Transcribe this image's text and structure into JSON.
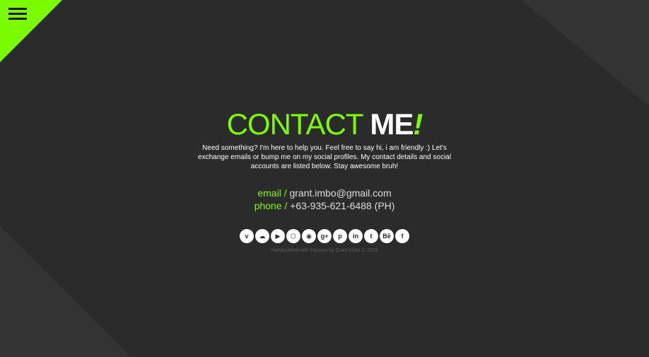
{
  "header": {
    "title_part1": "CONTACT",
    "title_part2": "ME",
    "title_part3": "!"
  },
  "intro": {
    "text": "Need something? I'm here to help you. Feel free to say hi, i am friendly :) Let's exchange emails or bump me on my social profiles. My contact details and social accounts are listed below. Stay awesome bruh!"
  },
  "contact": {
    "email_label": "email /",
    "email_value": "grant.imbo@gmail.com",
    "phone_label": "phone /",
    "phone_value": "+63-935-621-6488 (PH)"
  },
  "social": [
    {
      "name": "vimeo-icon",
      "glyph": "v"
    },
    {
      "name": "soundcloud-icon",
      "glyph": "☁"
    },
    {
      "name": "youtube-icon",
      "glyph": "▶"
    },
    {
      "name": "codepen-icon",
      "glyph": "⬡"
    },
    {
      "name": "github-icon",
      "glyph": "◉"
    },
    {
      "name": "google-plus-icon",
      "glyph": "g+"
    },
    {
      "name": "pinterest-icon",
      "glyph": "p"
    },
    {
      "name": "linkedin-icon",
      "glyph": "in"
    },
    {
      "name": "twitter-icon",
      "glyph": "t"
    },
    {
      "name": "behance-icon",
      "glyph": "Bē"
    },
    {
      "name": "facebook-icon",
      "glyph": "f"
    }
  ],
  "footer": {
    "text": "Handcrafted with Passion by Grant Imbo © 2015"
  },
  "colors": {
    "accent": "#7cfc00",
    "background": "#2b2b2b"
  }
}
